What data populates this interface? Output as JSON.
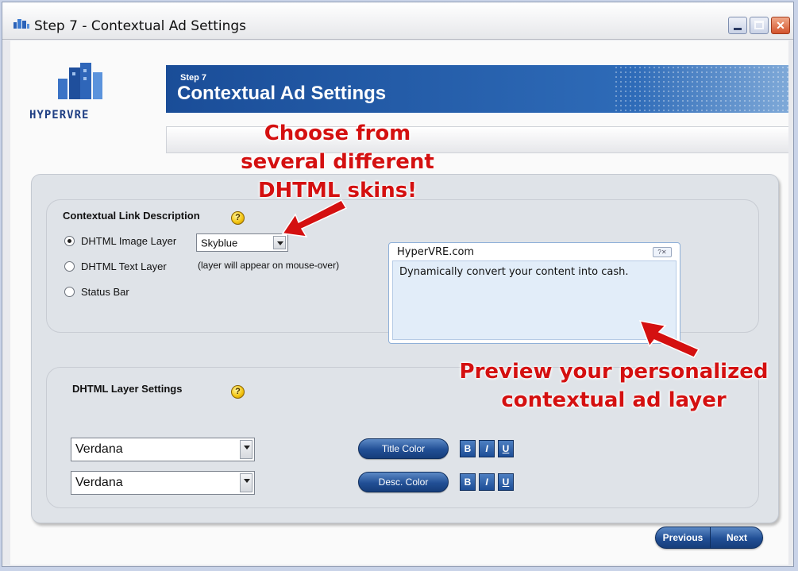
{
  "window": {
    "title": "Step 7 - Contextual Ad Settings",
    "controls": {
      "minimize": "",
      "maximize": "",
      "close": "✕"
    }
  },
  "logo": {
    "text": "HYPERVRE"
  },
  "header": {
    "step": "Step 7",
    "title": "Contextual Ad Settings"
  },
  "callouts": {
    "skins_line1": "Choose from",
    "skins_line2": "several different",
    "skins_line3": "DHTML skins!",
    "preview_line1": "Preview your personalized",
    "preview_line2": "contextual ad layer"
  },
  "contextual_link": {
    "heading": "Contextual Link Description",
    "options": [
      {
        "label": "DHTML Image Layer",
        "selected": true
      },
      {
        "label": "DHTML Text Layer",
        "selected": false
      },
      {
        "label": "Status Bar",
        "selected": false
      }
    ],
    "skin_select": {
      "value": "Skyblue"
    },
    "note": "(layer will appear on mouse-over)"
  },
  "preview": {
    "title": "HyperVRE.com",
    "body": "Dynamically convert your content into cash."
  },
  "layer_settings": {
    "heading": "DHTML Layer Settings",
    "title_font": "Verdana",
    "desc_font": "Verdana",
    "title_color_label": "Title Color",
    "desc_color_label": "Desc. Color",
    "bold": "B",
    "italic": "I",
    "underline": "U"
  },
  "nav": {
    "previous": "Previous",
    "next": "Next"
  },
  "help_glyph": "?",
  "colors": {
    "accent": "#1a4d98",
    "callout": "#d41010",
    "button": "#214f95"
  }
}
